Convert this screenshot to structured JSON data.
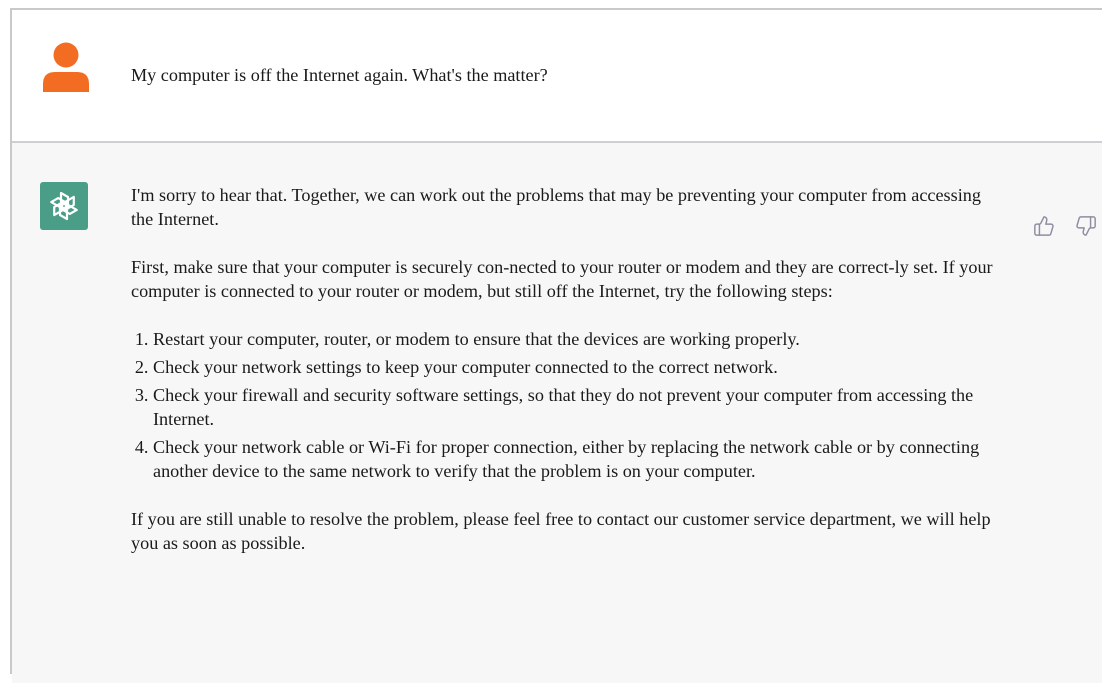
{
  "conversation": {
    "user_message": "My computer is off the Internet again. What's the matter?",
    "assistant": {
      "intro": "I'm sorry to hear that. Together, we can work out the problems that may be preventing your computer from accessing the Internet.",
      "paragraph2": "First, make sure that your computer is securely con-nected to your router or modem and they are correct-ly set. If your computer is connected to your router or modem, but still off the Internet, try the following steps:",
      "steps": [
        "Restart your computer, router, or modem to ensure that the devices are working properly.",
        "Check your network settings to keep your computer connected to the correct network.",
        "Check your firewall and security software settings, so that they do not prevent your computer from accessing the Internet.",
        "Check your network cable or Wi-Fi for proper connection, either by replacing the network cable or by connecting another device to the same network to verify that the problem is on your computer."
      ],
      "closing": "If you are still unable to resolve the problem, please feel free to contact our customer service department, we will help you as soon as possible."
    }
  },
  "icons": {
    "user_avatar": "user-avatar-icon",
    "assistant_avatar": "openai-logo-icon",
    "thumbs_up": "thumbs-up-icon",
    "thumbs_down": "thumbs-down-icon"
  },
  "colors": {
    "user_avatar": "#f26d21",
    "assistant_avatar_bg": "#4a9d86",
    "assistant_row_bg": "#f7f7f8",
    "user_row_bg": "#ffffff",
    "divider": "#cfcfd3",
    "feedback_icon": "#8e8ea0"
  }
}
